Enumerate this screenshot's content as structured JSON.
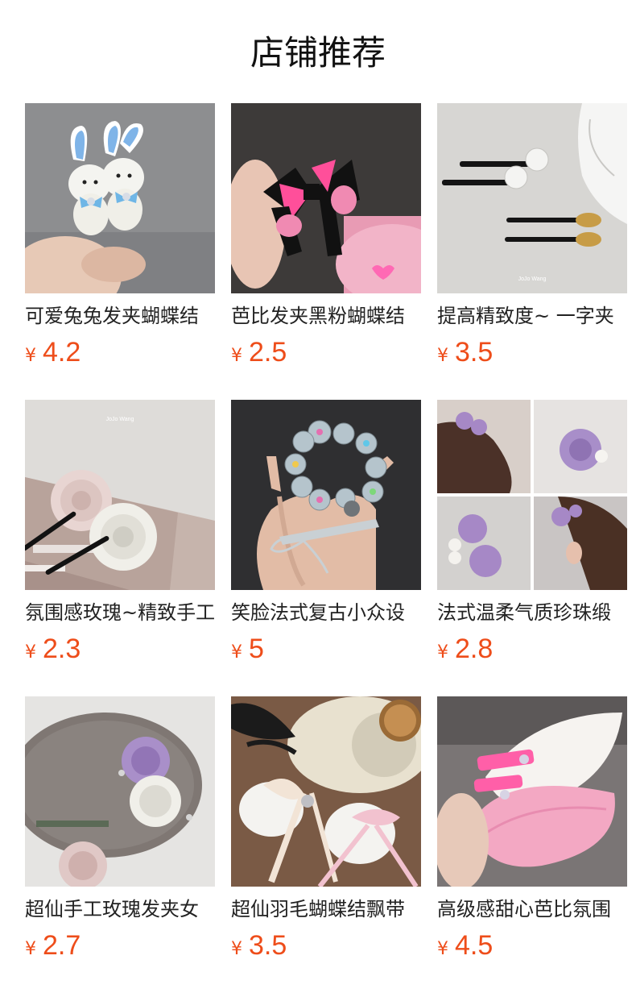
{
  "header": {
    "title": "店铺推荐"
  },
  "currency": "¥",
  "products": [
    {
      "title": "可爱兔兔发夹蝴蝶结",
      "price": "4.2",
      "icon": "bunny-hairclip-image"
    },
    {
      "title": "芭比发夹黑粉蝴蝶结",
      "price": "2.5",
      "icon": "bow-hairclip-image"
    },
    {
      "title": "提高精致度~ 一字夹",
      "price": "3.5",
      "icon": "pearl-pin-image",
      "watermark": "JoJo Wang"
    },
    {
      "title": "氛围感玫瑰~精致手工",
      "price": "2.3",
      "icon": "rose-hairpin-image",
      "watermark": "JoJo Wang"
    },
    {
      "title": "笑脸法式复古小众设",
      "price": "5",
      "icon": "crystal-clip-image"
    },
    {
      "title": "法式温柔气质珍珠缎",
      "price": "2.8",
      "icon": "purple-rose-clip-image"
    },
    {
      "title": "超仙手工玫瑰发夹女",
      "price": "2.7",
      "icon": "satin-rose-clip-image"
    },
    {
      "title": "超仙羽毛蝴蝶结飘带",
      "price": "3.5",
      "icon": "feather-bow-image"
    },
    {
      "title": "高级感甜心芭比氛围",
      "price": "4.5",
      "icon": "barbie-feather-clip-image"
    }
  ]
}
